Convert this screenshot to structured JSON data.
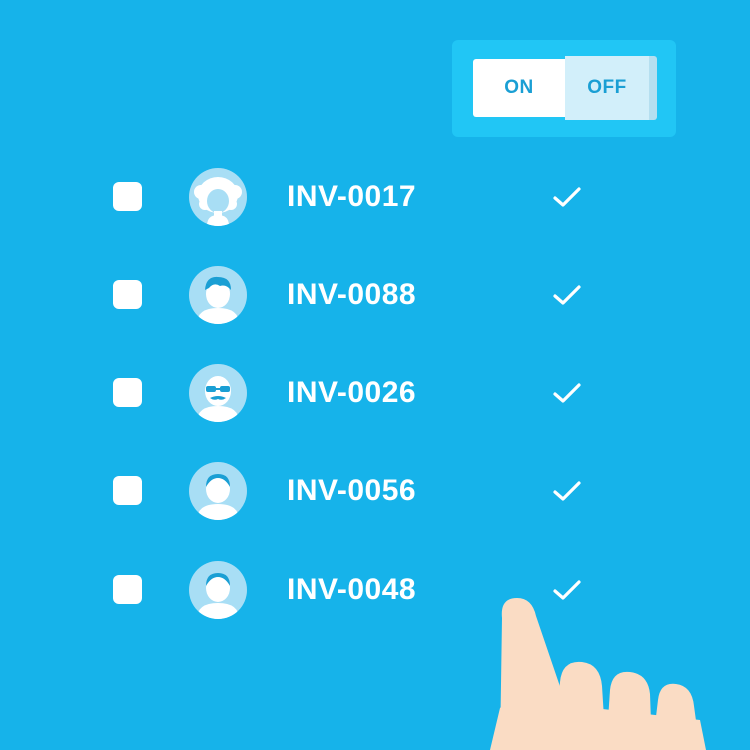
{
  "toggle": {
    "on_label": "ON",
    "off_label": "OFF",
    "state": "on"
  },
  "invoices": [
    {
      "id": "INV-0017",
      "avatar": "avatar-curly-hair-icon",
      "checked": false,
      "status": "check-icon"
    },
    {
      "id": "INV-0088",
      "avatar": "avatar-short-hair-icon",
      "checked": false,
      "status": "check-icon"
    },
    {
      "id": "INV-0026",
      "avatar": "avatar-glasses-mustache-icon",
      "checked": false,
      "status": "check-icon"
    },
    {
      "id": "INV-0056",
      "avatar": "avatar-person-icon",
      "checked": false,
      "status": "check-icon"
    },
    {
      "id": "INV-0048",
      "avatar": "avatar-person-icon",
      "checked": false,
      "status": "check-icon"
    }
  ],
  "colors": {
    "background": "#16b3ea",
    "toggle_panel": "#21c6f5",
    "text": "#ffffff",
    "accent_text": "#1a9fd4",
    "avatar_bg": "#a8def5",
    "skin": "#fadcc4"
  }
}
